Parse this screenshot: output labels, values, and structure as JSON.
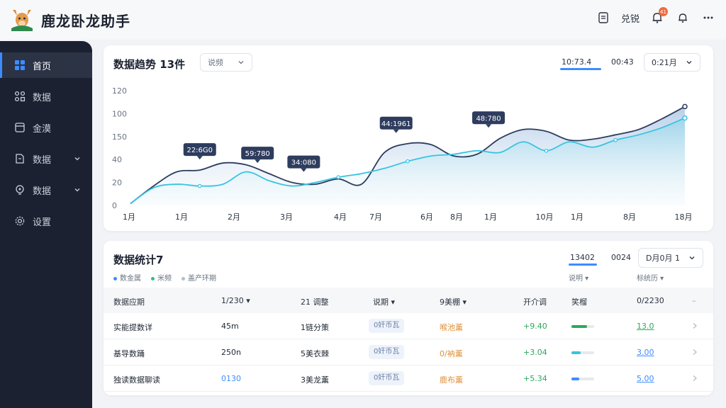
{
  "app": {
    "title": "鹿龙卧龙助手"
  },
  "header": {
    "action_label": "兑锐",
    "notification_count": "41"
  },
  "sidebar": {
    "items": [
      {
        "label": "首页",
        "icon": "grid-icon",
        "active": true
      },
      {
        "label": "数据",
        "icon": "nodes-icon",
        "active": false
      },
      {
        "label": "金漠",
        "icon": "box-icon",
        "active": false
      },
      {
        "label": "数据",
        "icon": "file-icon",
        "active": false,
        "expandable": true
      },
      {
        "label": "数据",
        "icon": "bulb-icon",
        "active": false,
        "expandable": true
      },
      {
        "label": "设置",
        "icon": "gear-icon",
        "active": false
      }
    ]
  },
  "trend": {
    "title": "数据趋势 13件",
    "select": "说频",
    "range_start": "10:73.4",
    "range_mid": "00:43",
    "range_select": "0:21月"
  },
  "chart_data": {
    "type": "area",
    "y_ticks": [
      "120",
      "100",
      "150",
      "40",
      "20",
      "0"
    ],
    "x_ticks": [
      "1月",
      "1月",
      "2月",
      "3月",
      "4月",
      "7月",
      "6月",
      "8月",
      "1月",
      "10月",
      "1月",
      "8月",
      "18月"
    ],
    "ylim": [
      0,
      130
    ],
    "colors": {
      "dark": "#2e3c5e",
      "light": "#36c4e0",
      "fill": "#8fb6dc"
    },
    "series": [
      {
        "x": [
          0,
          1,
          2,
          3,
          4,
          5,
          6,
          7,
          8,
          9,
          10,
          11,
          12,
          13,
          14,
          15,
          16,
          17,
          18,
          19,
          20,
          21,
          22,
          23,
          24
        ],
        "values": [
          2,
          22,
          38,
          40,
          48,
          46,
          36,
          26,
          24,
          30,
          24,
          60,
          70,
          69,
          56,
          58,
          76,
          86,
          84,
          74,
          75,
          80,
          86,
          98,
          112
        ]
      },
      {
        "x": [
          0,
          1,
          2,
          3,
          4,
          5,
          6,
          7,
          8,
          9,
          10,
          11,
          12,
          13,
          14,
          15,
          16,
          17,
          18,
          19,
          20,
          21,
          22,
          23,
          24
        ],
        "values": [
          2,
          20,
          24,
          22,
          24,
          38,
          28,
          22,
          26,
          32,
          36,
          42,
          50,
          56,
          58,
          62,
          60,
          72,
          62,
          72,
          66,
          74,
          80,
          88,
          99
        ]
      }
    ],
    "annotations": [
      {
        "label": "22:6G0",
        "x": 3
      },
      {
        "label": "59:780",
        "x": 5.5
      },
      {
        "label": "34:080",
        "x": 7.5
      },
      {
        "label": "44:1961",
        "x": 11.5
      },
      {
        "label": "48:780",
        "x": 15.5
      }
    ]
  },
  "stats": {
    "title": "数据统计7",
    "range_start": "13402",
    "range_mid": "0024",
    "range_select": "D月0月 1",
    "legend": [
      {
        "label": "数金属",
        "color": "#3d8cff"
      },
      {
        "label": "米频",
        "color": "#2ec27e"
      },
      {
        "label": "盖产环期",
        "color": "#b7bdc7"
      }
    ],
    "sub_label_a": "说明",
    "sub_label_b": "标统历",
    "columns": [
      "数据应期",
      "1/230",
      "21 调整",
      "说期",
      "9美棚",
      "开介调",
      "笑榴",
      "0/2230"
    ],
    "rows": [
      {
        "name": "实能提数详",
        "c1": "45m",
        "c2": "1链分策",
        "pill": "0奸币瓦",
        "status": "喉池薰",
        "delta": "+9.40",
        "bar": 0.7,
        "bar_color": "#2ea85b",
        "value": "13.0"
      },
      {
        "name": "基导数踊",
        "c1": "250n",
        "c2": "5美衣棘",
        "pill": "0奸币瓦",
        "status": "0/衲薰",
        "delta": "+3.04",
        "bar": 0.4,
        "bar_color": "#36c4e0",
        "value": "3.00"
      },
      {
        "name": "独读数据聊读",
        "c1": "0130",
        "c2": "3美龙薰",
        "pill": "0奸币瓦",
        "status": "鹿布薰",
        "delta": "+5.34",
        "bar": 0.35,
        "bar_color": "#3d8cff",
        "value": "5.00"
      }
    ]
  }
}
